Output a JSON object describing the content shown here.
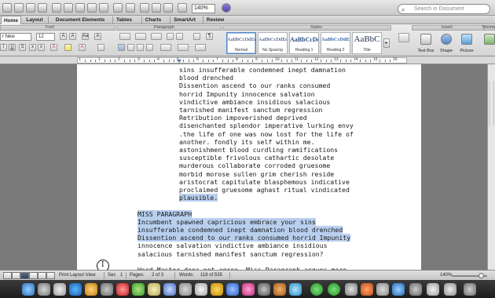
{
  "toolbar": {
    "zoom_value": "140%",
    "search_placeholder": "Search in Document"
  },
  "ribbon_tabs": [
    "Home",
    "Layout",
    "Document Elements",
    "Tables",
    "Charts",
    "SmartArt",
    "Review"
  ],
  "ribbon": {
    "font_group": "Font",
    "paragraph_group": "Paragraph",
    "styles_group": "Styles",
    "insert_group": "Insert",
    "themes_group": "Theme",
    "font_name": "r New",
    "font_size": "12",
    "styles": [
      {
        "sample": "AaBbCcDdEe",
        "name": "Normal"
      },
      {
        "sample": "AaBbCcDdEe",
        "name": "No Spacing"
      },
      {
        "sample": "AaBbCcDc",
        "name": "Heading 1"
      },
      {
        "sample": "AaBbCcDdEe",
        "name": "Heading 2"
      },
      {
        "sample": "AaBbC",
        "name": "Title"
      }
    ],
    "insert_buttons": [
      "Text Box",
      "Shape",
      "Picture"
    ],
    "themes_buttons": [
      "Themes"
    ]
  },
  "ruler": {
    "numbers": [
      "1",
      "1",
      "2",
      "3",
      "4",
      "5",
      "6",
      "7",
      "8",
      "9",
      "10",
      "11",
      "12",
      "13",
      "14",
      "15",
      "16"
    ]
  },
  "document": {
    "lines": [
      {
        "text": "sins insufferable condemned inept damnation",
        "indent": "para",
        "selected": false
      },
      {
        "text": "blood drenched",
        "indent": "para",
        "selected": false
      },
      {
        "text": "Dissention ascend to our ranks consumed",
        "indent": "para",
        "selected": false
      },
      {
        "text": "horrid Impunity innocence salvation",
        "indent": "para",
        "selected": false
      },
      {
        "text": "vindictive ambiance insidious salacious",
        "indent": "para",
        "selected": false
      },
      {
        "text": "tarnished manifest sanctum regression",
        "indent": "para",
        "selected": false
      },
      {
        "text": "Retribution impoverished deprived",
        "indent": "para",
        "selected": false
      },
      {
        "text": "disenchanted splendor imperative lurking envy",
        "indent": "para",
        "selected": false
      },
      {
        "text": ".the life of one was now lost for the life of",
        "indent": "para",
        "selected": false
      },
      {
        "text": "another. fondly its self within me.",
        "indent": "para",
        "selected": false
      },
      {
        "text": "astonishment blood curdling ramifications",
        "indent": "para",
        "selected": false
      },
      {
        "text": "susceptible frivolous cathartic desolate",
        "indent": "para",
        "selected": false
      },
      {
        "text": "murderous collaborate corroded gruesome",
        "indent": "para",
        "selected": false
      },
      {
        "text": "morbid morose sullen grim cherish reside",
        "indent": "para",
        "selected": false
      },
      {
        "text": "aristocrat capitulate blasphemous indicative",
        "indent": "para",
        "selected": false
      },
      {
        "text": "proclaimed gruesome aghast ritual vindicated",
        "indent": "para",
        "selected": false
      },
      {
        "text": "plausible.",
        "indent": "para",
        "selected": true
      },
      {
        "text": "",
        "indent": "left",
        "selected": false
      },
      {
        "text": "MISS PARAGRAPH",
        "indent": "left",
        "selected": true
      },
      {
        "text": "Incumbent spawned capricious embrace your sins",
        "indent": "left",
        "selected": true
      },
      {
        "text": "insufferable condemned inept damnation blood drenched",
        "indent": "left",
        "selected": true
      },
      {
        "text": "Dissention ascend to our ranks consumed horrid Impunity",
        "indent": "left",
        "selected": true
      },
      {
        "text": "innocence salvation vindictive ambiance insidious",
        "indent": "left",
        "selected": false
      },
      {
        "text": "salacious tarnished manifest sanctum regression?",
        "indent": "left",
        "selected": false
      },
      {
        "text": "",
        "indent": "left",
        "selected": false
      },
      {
        "text": "Word Master does not agree. Miss Paragraph argues more",
        "indent": "left",
        "selected": false
      }
    ]
  },
  "status_bar": {
    "view_label": "Print Layout View",
    "section": "Sec",
    "section_num": "1",
    "pages_label": "Pages:",
    "pages_value": "2 of 3",
    "words_label": "Words:",
    "words_value": "118 of 535",
    "zoom": "140%"
  },
  "colors": {
    "selection": "#b9cfee",
    "accent": "#4f86c6"
  }
}
